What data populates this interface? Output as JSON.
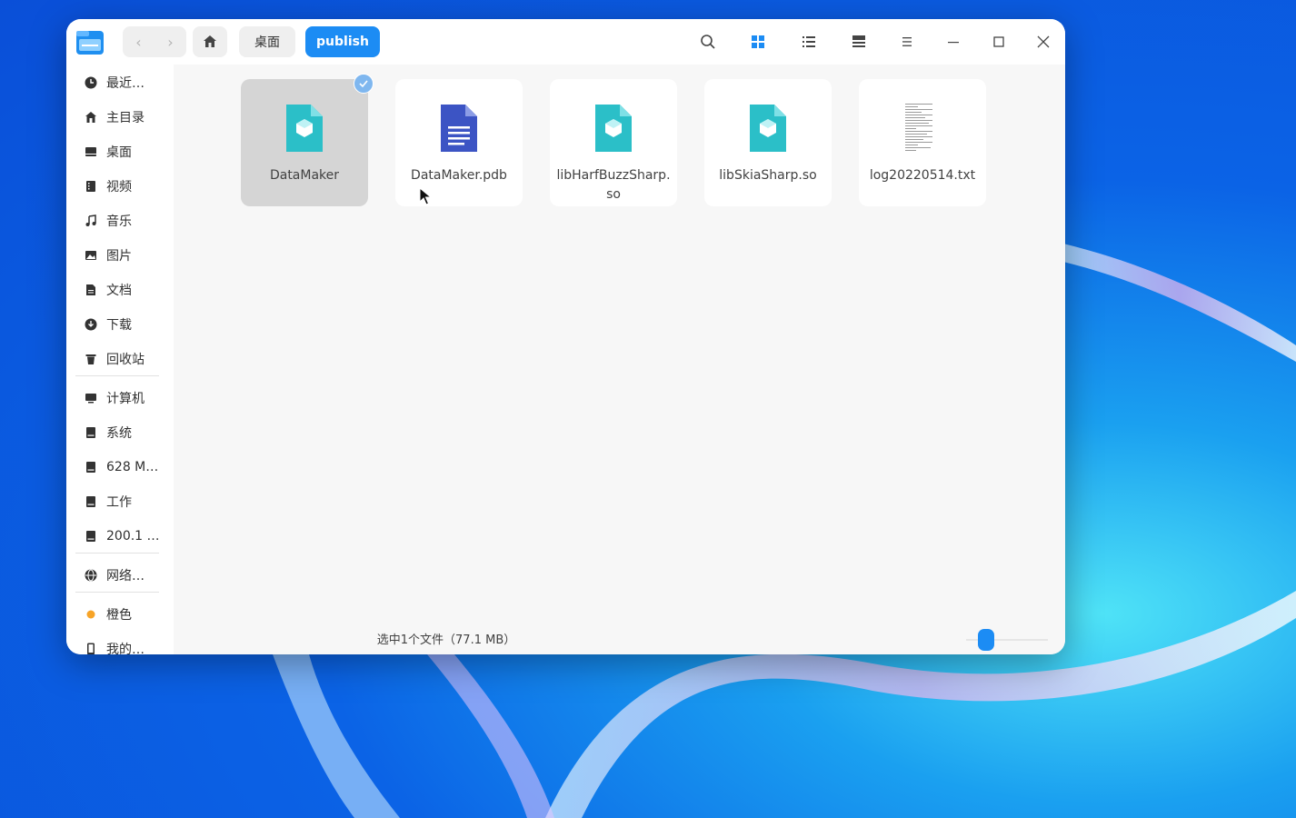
{
  "breadcrumb": {
    "items": [
      "桌面",
      "publish"
    ]
  },
  "sidebar": {
    "items": [
      {
        "label": "最近…",
        "icon": "clock-icon"
      },
      {
        "label": "主目录",
        "icon": "home-icon"
      },
      {
        "label": "桌面",
        "icon": "desktop-icon"
      },
      {
        "label": "视频",
        "icon": "video-icon"
      },
      {
        "label": "音乐",
        "icon": "music-icon"
      },
      {
        "label": "图片",
        "icon": "image-icon"
      },
      {
        "label": "文档",
        "icon": "document-icon"
      },
      {
        "label": "下载",
        "icon": "download-icon"
      },
      {
        "label": "回收站",
        "icon": "trash-icon"
      },
      {
        "label": "计算机",
        "icon": "computer-icon"
      },
      {
        "label": "系统",
        "icon": "drive-icon"
      },
      {
        "label": "628 M…",
        "icon": "drive-icon"
      },
      {
        "label": "工作",
        "icon": "drive-icon"
      },
      {
        "label": "200.1 …",
        "icon": "drive-icon"
      },
      {
        "label": "网络…",
        "icon": "network-icon"
      },
      {
        "label": "橙色",
        "icon": "orange-tag-icon"
      },
      {
        "label": "我的…",
        "icon": "phone-icon"
      }
    ]
  },
  "files": [
    {
      "name": "DataMaker",
      "icon": "executable-icon",
      "selected": true
    },
    {
      "name": "DataMaker.pdb",
      "icon": "document-file-icon",
      "selected": false
    },
    {
      "name": "libHarfBuzzSharp.so",
      "icon": "library-icon",
      "selected": false
    },
    {
      "name": "libSkiaSharp.so",
      "icon": "library-icon",
      "selected": false
    },
    {
      "name": "log20220514.txt",
      "icon": "text-file-icon",
      "selected": false
    }
  ],
  "status": {
    "text": "选中1个文件（77.1 MB）"
  },
  "colors": {
    "accent": "#1c8cf4",
    "selected_bg": "#d5d5d5",
    "library_teal": "#2bbfc8",
    "doc_blue": "#3c54c4"
  }
}
